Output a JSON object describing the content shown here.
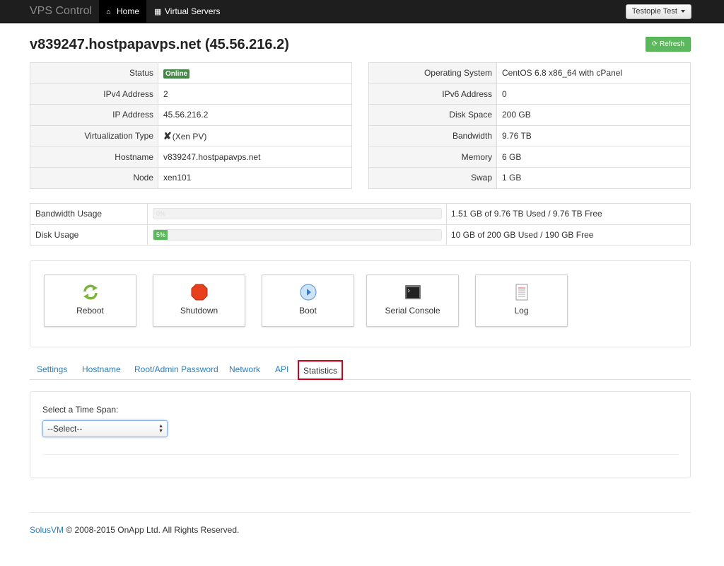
{
  "navbar": {
    "brand": "VPS Control",
    "home": "Home",
    "virtual_servers": "Virtual Servers",
    "user": "Testopie Test"
  },
  "header": {
    "title": "v839247.hostpapavps.net (45.56.216.2)",
    "refresh": "Refresh"
  },
  "info_left": [
    {
      "label": "Status",
      "value": "Online"
    },
    {
      "label": "IPv4 Address",
      "value": "2"
    },
    {
      "label": "IP Address",
      "value": "45.56.216.2"
    },
    {
      "label": "Virtualization Type",
      "value": "(Xen PV)"
    },
    {
      "label": "Hostname",
      "value": "v839247.hostpapavps.net"
    },
    {
      "label": "Node",
      "value": "xen101"
    }
  ],
  "info_right": [
    {
      "label": "Operating System",
      "value": "CentOS 6.8 x86_64 with cPanel"
    },
    {
      "label": "IPv6 Address",
      "value": "0"
    },
    {
      "label": "Disk Space",
      "value": "200 GB"
    },
    {
      "label": "Bandwidth",
      "value": "9.76 TB"
    },
    {
      "label": "Memory",
      "value": "6 GB"
    },
    {
      "label": "Swap",
      "value": "1 GB"
    }
  ],
  "usage": [
    {
      "label": "Bandwidth Usage",
      "percent": 0,
      "percent_label": "0%",
      "text": "1.51 GB of 9.76 TB Used / 9.76 TB Free"
    },
    {
      "label": "Disk Usage",
      "percent": 5,
      "percent_label": "5%",
      "text": "10 GB of 200 GB Used / 190 GB Free"
    }
  ],
  "actions": {
    "reboot": "Reboot",
    "shutdown": "Shutdown",
    "boot": "Boot",
    "serial_console": "Serial Console",
    "log": "Log"
  },
  "tabs": {
    "settings": "Settings",
    "hostname": "Hostname",
    "root_password": "Root/Admin Password",
    "network": "Network",
    "api": "API",
    "statistics": "Statistics"
  },
  "statistics": {
    "label": "Select a Time Span:",
    "select_value": "--Select--"
  },
  "footer": {
    "link": "SolusVM",
    "text": " © 2008-2015 OnApp Ltd. All Rights Reserved."
  },
  "colors": {
    "online_badge": "#468847",
    "refresh_button": "#5cb85c",
    "link": "#2a7fbf",
    "active_tab_highlight": "#d0021b"
  }
}
